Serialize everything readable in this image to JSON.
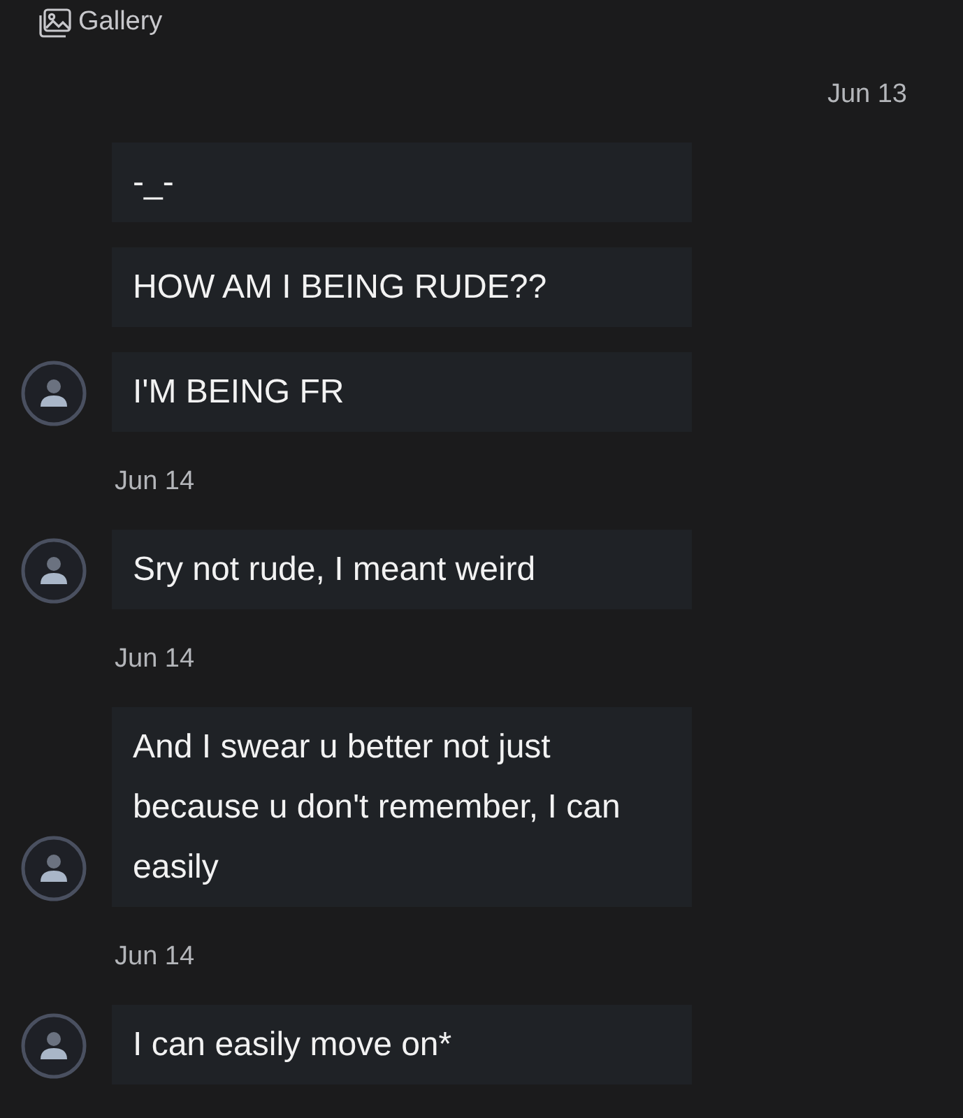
{
  "header": {
    "label": "Gallery"
  },
  "items": [
    {
      "kind": "sent_date",
      "text": "Jun 13"
    },
    {
      "kind": "message",
      "text": "-_-",
      "avatar": false
    },
    {
      "kind": "message",
      "text": "HOW AM I BEING RUDE??",
      "avatar": false
    },
    {
      "kind": "message",
      "text": "I'M BEING FR",
      "avatar": true
    },
    {
      "kind": "received_date",
      "text": "Jun 14"
    },
    {
      "kind": "message",
      "text": "Sry not rude, I meant weird",
      "avatar": true
    },
    {
      "kind": "received_date",
      "text": "Jun 14"
    },
    {
      "kind": "message",
      "text": "And I swear u better not just because u don't remember, I can easily",
      "avatar": true
    },
    {
      "kind": "received_date",
      "text": "Jun 14"
    },
    {
      "kind": "message",
      "text": "I can easily move on*",
      "avatar": true
    }
  ]
}
